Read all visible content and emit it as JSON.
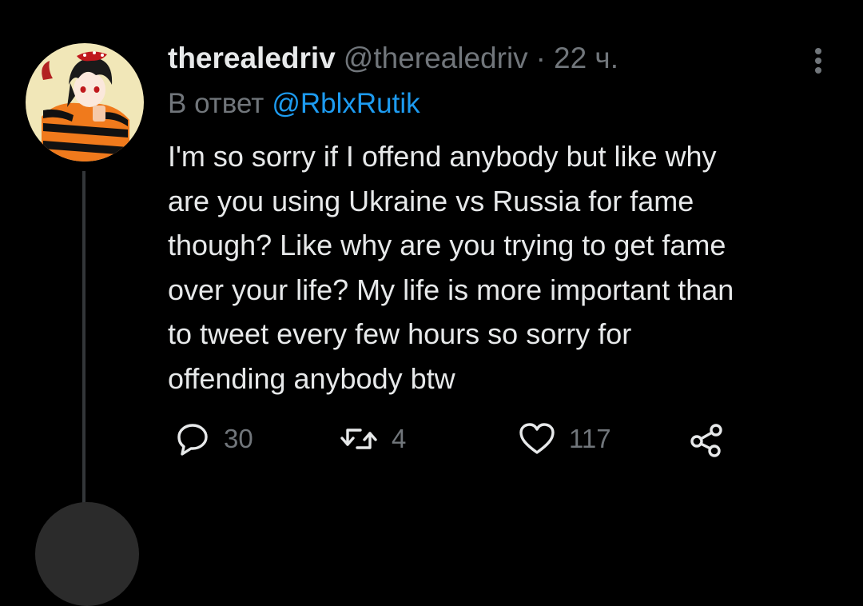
{
  "colors": {
    "background": "#000000",
    "text_primary": "#e7e9ea",
    "text_secondary": "#71767b",
    "link": "#1d9bf0",
    "thread_line": "#333639"
  },
  "tweet": {
    "display_name": "therealedriv",
    "handle": "@therealedriv",
    "separator": "·",
    "time": "22 ч.",
    "reply_prefix": "В ответ",
    "reply_handle": "@RblxRutik",
    "body_lines": [
      "I'm so sorry if I offend anybody but like why",
      "are you using Ukraine vs Russia for fame",
      "though? Like why are you trying to get fame",
      "over your life? My life is more important than",
      "to tweet every few hours so sorry for",
      "offending anybody btw"
    ],
    "actions": {
      "reply_icon": "reply-icon",
      "reply_count": "30",
      "retweet_icon": "retweet-icon",
      "retweet_count": "4",
      "like_icon": "heart-icon",
      "like_count": "117",
      "share_icon": "share-icon"
    },
    "more_icon": "more-vertical-icon"
  }
}
